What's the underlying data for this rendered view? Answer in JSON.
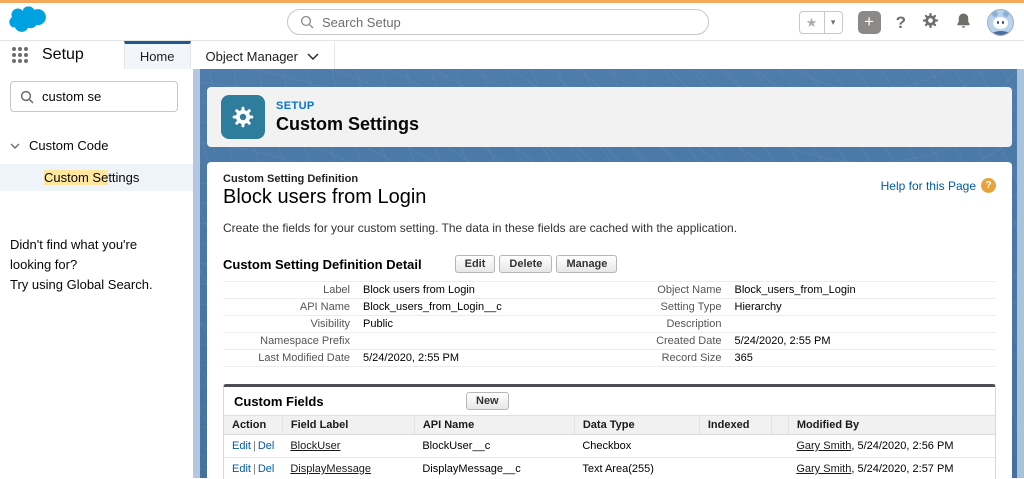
{
  "colors": {
    "brand_blue": "#00a1e0",
    "accent_blue": "#0176d3",
    "link_blue": "#015ba7",
    "workspace_blue": "#4a77a7",
    "top_strip_orange": "#f5a75b",
    "highlight_yellow": "#ffe79e",
    "setup_tile_teal": "#2e7d9c",
    "help_icon_orange": "#e8a33d",
    "active_tab_indicator": "#20598f"
  },
  "icons": {
    "logo": "salesforce-cloud",
    "app_launcher": "waffle",
    "search": "magnifier",
    "favorites_star": "★",
    "favorites_caret": "▾",
    "add_plus": "+",
    "help_q": "?",
    "setup_gear": "gear",
    "notifications": "bell",
    "avatar": "astro",
    "help_badge": "?"
  },
  "global_header": {
    "search_placeholder": "Search Setup"
  },
  "nav": {
    "app_name": "Setup",
    "tabs": [
      {
        "label": "Home"
      },
      {
        "label": "Object Manager"
      }
    ]
  },
  "sidebar": {
    "search_value": "custom se",
    "group_label": "Custom Code",
    "item_highlight": "Custom Se",
    "item_rest": "ttings",
    "footer_line1": "Didn't find what you're looking for?",
    "footer_line2": "Try using Global Search."
  },
  "page_header": {
    "eyebrow": "SETUP",
    "title": "Custom Settings"
  },
  "content": {
    "definition_label": "Custom Setting Definition",
    "title": "Block users from Login",
    "help_link": "Help for this Page",
    "description": "Create the fields for your custom setting. The data in these fields are cached with the application.",
    "detail": {
      "heading": "Custom Setting Definition Detail",
      "buttons": [
        "Edit",
        "Delete",
        "Manage"
      ],
      "left_rows": [
        [
          "Label",
          "Block users from Login"
        ],
        [
          "API Name",
          "Block_users_from_Login__c"
        ],
        [
          "Visibility",
          "Public"
        ],
        [
          "Namespace Prefix",
          ""
        ],
        [
          "Last Modified Date",
          "5/24/2020, 2:55 PM"
        ]
      ],
      "right_rows": [
        [
          "Object Name",
          "Block_users_from_Login"
        ],
        [
          "Setting Type",
          "Hierarchy"
        ],
        [
          "Description",
          ""
        ],
        [
          "Created Date",
          "5/24/2020, 2:55 PM"
        ],
        [
          "Record Size",
          "365"
        ]
      ]
    },
    "custom_fields": {
      "heading": "Custom Fields",
      "new_button": "New",
      "edit_label": "Edit",
      "del_label": "Del",
      "sep": "|",
      "columns": [
        "Action",
        "Field Label",
        "API Name",
        "Data Type",
        "Indexed",
        "Modified By"
      ],
      "rows": [
        {
          "field_label": "BlockUser",
          "api_name": "BlockUser__c",
          "data_type": "Checkbox",
          "indexed": "",
          "modified_by": "Gary Smith",
          "modified_date": ", 5/24/2020, 2:56 PM"
        },
        {
          "field_label": "DisplayMessage",
          "api_name": "DisplayMessage__c",
          "data_type": "Text Area(255)",
          "indexed": "",
          "modified_by": "Gary Smith",
          "modified_date": ", 5/24/2020, 2:57 PM"
        }
      ]
    }
  }
}
